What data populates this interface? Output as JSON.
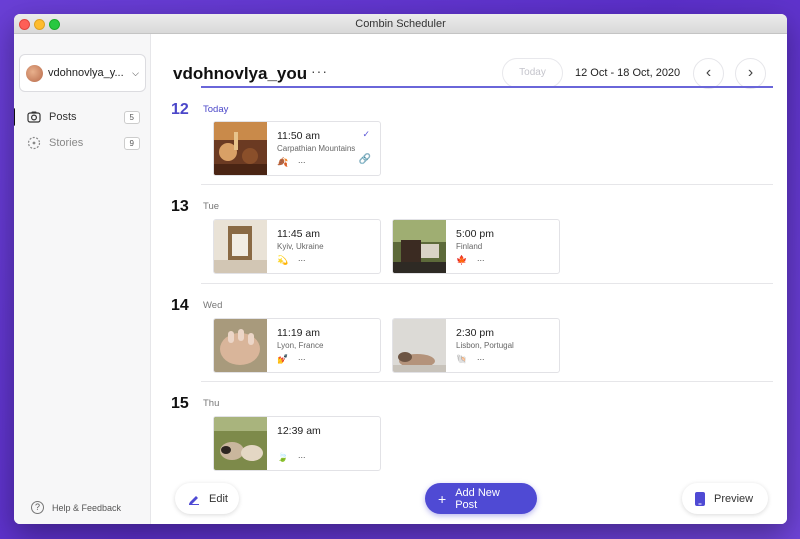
{
  "window": {
    "title": "Combin Scheduler"
  },
  "sidebar": {
    "account_name": "vdohnovlya_y...",
    "items": [
      {
        "label": "Posts",
        "count": "5",
        "icon": "camera-icon"
      },
      {
        "label": "Stories",
        "count": "9",
        "icon": "stories-icon"
      }
    ],
    "help_label": "Help & Feedback"
  },
  "header": {
    "title": "vdohnovlya_you",
    "more": "···",
    "today_label": "Today",
    "date_range": "12 Oct - 18 Oct, 2020"
  },
  "days": [
    {
      "number": "12",
      "name": "Today",
      "posts": [
        {
          "time": "11:50 am",
          "location": "Carpathian Mountains",
          "emoji": "🍂",
          "dots": "...",
          "check": "✓",
          "link": "🔗"
        }
      ]
    },
    {
      "number": "13",
      "name": "Tue",
      "posts": [
        {
          "time": "11:45 am",
          "location": "Kyiv, Ukraine",
          "emoji": "💫",
          "dots": "..."
        },
        {
          "time": "5:00 pm",
          "location": "Finland",
          "emoji": "🍁",
          "dots": "..."
        }
      ]
    },
    {
      "number": "14",
      "name": "Wed",
      "posts": [
        {
          "time": "11:19 am",
          "location": "Lyon, France",
          "emoji": "💅",
          "dots": "..."
        },
        {
          "time": "2:30 pm",
          "location": "Lisbon, Portugal",
          "emoji": "🐚",
          "dots": "..."
        }
      ]
    },
    {
      "number": "15",
      "name": "Thu",
      "posts": [
        {
          "time": "12:39 am",
          "location": "",
          "emoji": "🍃",
          "dots": "..."
        }
      ]
    }
  ],
  "footer": {
    "edit_label": "Edit",
    "add_label": "Add New Post",
    "preview_label": "Preview"
  },
  "colors": {
    "accent": "#4f4ad4",
    "background": "#6a3fd6"
  }
}
